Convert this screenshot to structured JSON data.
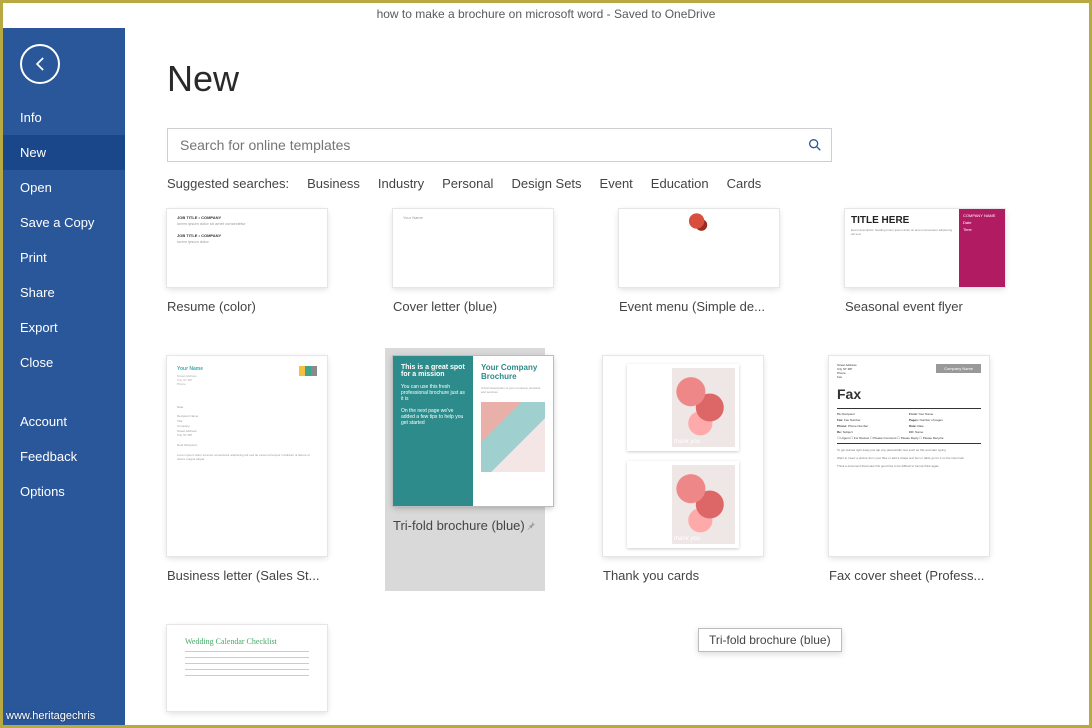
{
  "title": "how to make a brochure on microsoft word  -  Saved to OneDrive",
  "sidebar": {
    "items": [
      {
        "label": "Info"
      },
      {
        "label": "New"
      },
      {
        "label": "Open"
      },
      {
        "label": "Save a Copy"
      },
      {
        "label": "Print"
      },
      {
        "label": "Share"
      },
      {
        "label": "Export"
      },
      {
        "label": "Close"
      }
    ],
    "items2": [
      {
        "label": "Account"
      },
      {
        "label": "Feedback"
      },
      {
        "label": "Options"
      }
    ]
  },
  "page_heading": "New",
  "search": {
    "placeholder": "Search for online templates"
  },
  "suggested": {
    "label": "Suggested searches:",
    "links": [
      "Business",
      "Industry",
      "Personal",
      "Design Sets",
      "Event",
      "Education",
      "Cards"
    ]
  },
  "templates_row1": [
    {
      "label": "Resume (color)"
    },
    {
      "label": "Cover letter (blue)"
    },
    {
      "label": "Event menu (Simple de..."
    },
    {
      "label": "Seasonal event flyer"
    }
  ],
  "templates_row2": [
    {
      "label": "Business letter (Sales St..."
    },
    {
      "label": "Tri-fold brochure (blue)"
    },
    {
      "label": "Thank you cards"
    },
    {
      "label": "Fax cover sheet (Profess..."
    }
  ],
  "templates_row3": [
    {
      "label": "Wedding Calendar Checklist"
    }
  ],
  "tooltip": "Tri-fold brochure (blue)",
  "thumb_text": {
    "flyer_title": "TITLE HERE",
    "flyer_company": "COMPANY NAME",
    "trifold_spot": "This is a great spot for a mission",
    "trifold_heading": "Your Company Brochure",
    "thank": "thank you",
    "fax_company": "Company Name",
    "fax_word": "Fax",
    "wed_title": "Wedding Calendar Checklist"
  },
  "watermark": "www.heritagechris"
}
